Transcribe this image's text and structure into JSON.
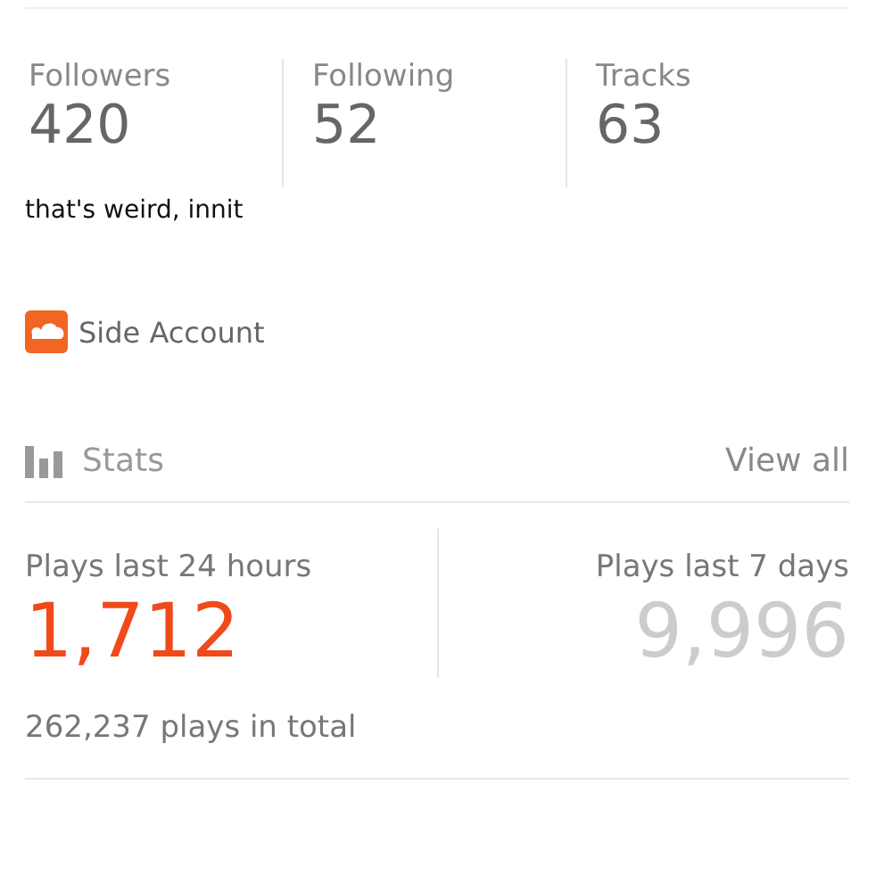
{
  "counts": [
    {
      "label": "Followers",
      "value": "420"
    },
    {
      "label": "Following",
      "value": "52"
    },
    {
      "label": "Tracks",
      "value": "63"
    }
  ],
  "bio": "that's weird, innit",
  "link": {
    "label": "Side Account"
  },
  "stats": {
    "title": "Stats",
    "view_all": "View all",
    "periods": [
      {
        "label": "Plays last 24 hours",
        "value": "1,712",
        "highlight": true
      },
      {
        "label": "Plays last 7 days",
        "value": "9,996",
        "highlight": false
      }
    ],
    "total": "262,237 plays in total"
  }
}
